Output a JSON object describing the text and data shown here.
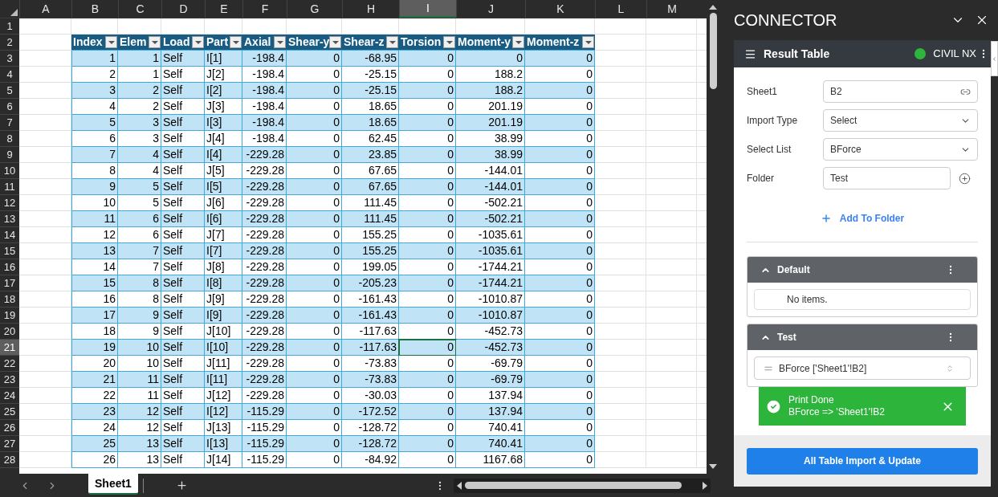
{
  "sheet": {
    "columns": [
      {
        "label": "A",
        "selected": false
      },
      {
        "label": "B",
        "selected": false
      },
      {
        "label": "C",
        "selected": false
      },
      {
        "label": "D",
        "selected": false
      },
      {
        "label": "E",
        "selected": false
      },
      {
        "label": "F",
        "selected": false
      },
      {
        "label": "G",
        "selected": false
      },
      {
        "label": "H",
        "selected": false
      },
      {
        "label": "I",
        "selected": true
      },
      {
        "label": "J",
        "selected": false
      },
      {
        "label": "K",
        "selected": false
      },
      {
        "label": "L",
        "selected": false
      },
      {
        "label": "M",
        "selected": false
      }
    ],
    "rows": [
      {
        "label": "1",
        "selected": false
      },
      {
        "label": "2",
        "selected": false
      },
      {
        "label": "3",
        "selected": false
      },
      {
        "label": "4",
        "selected": false
      },
      {
        "label": "5",
        "selected": false
      },
      {
        "label": "6",
        "selected": false
      },
      {
        "label": "7",
        "selected": false
      },
      {
        "label": "8",
        "selected": false
      },
      {
        "label": "9",
        "selected": false
      },
      {
        "label": "10",
        "selected": false
      },
      {
        "label": "11",
        "selected": false
      },
      {
        "label": "12",
        "selected": false
      },
      {
        "label": "13",
        "selected": false
      },
      {
        "label": "14",
        "selected": false
      },
      {
        "label": "15",
        "selected": false
      },
      {
        "label": "16",
        "selected": false
      },
      {
        "label": "17",
        "selected": false
      },
      {
        "label": "18",
        "selected": false
      },
      {
        "label": "19",
        "selected": false
      },
      {
        "label": "20",
        "selected": false
      },
      {
        "label": "21",
        "selected": true
      },
      {
        "label": "22",
        "selected": false
      },
      {
        "label": "23",
        "selected": false
      },
      {
        "label": "24",
        "selected": false
      },
      {
        "label": "25",
        "selected": false
      },
      {
        "label": "26",
        "selected": false
      },
      {
        "label": "27",
        "selected": false
      },
      {
        "label": "28",
        "selected": false
      }
    ],
    "table": {
      "columns": [
        {
          "label": "Index",
          "kind": "number"
        },
        {
          "label": "Elem",
          "kind": "number"
        },
        {
          "label": "Load",
          "kind": "text"
        },
        {
          "label": "Part",
          "kind": "text"
        },
        {
          "label": "Axial",
          "kind": "number"
        },
        {
          "label": "Shear-y",
          "kind": "number"
        },
        {
          "label": "Shear-z",
          "kind": "number"
        },
        {
          "label": "Torsion",
          "kind": "number"
        },
        {
          "label": "Moment-y",
          "kind": "number"
        },
        {
          "label": "Moment-z",
          "kind": "number"
        }
      ],
      "rows": [
        [
          "1",
          "1",
          "Self",
          "I[1]",
          "-198.4",
          "0",
          "-68.95",
          "0",
          "0",
          "0"
        ],
        [
          "2",
          "1",
          "Self",
          "J[2]",
          "-198.4",
          "0",
          "-25.15",
          "0",
          "188.2",
          "0"
        ],
        [
          "3",
          "2",
          "Self",
          "I[2]",
          "-198.4",
          "0",
          "-25.15",
          "0",
          "188.2",
          "0"
        ],
        [
          "4",
          "2",
          "Self",
          "J[3]",
          "-198.4",
          "0",
          "18.65",
          "0",
          "201.19",
          "0"
        ],
        [
          "5",
          "3",
          "Self",
          "I[3]",
          "-198.4",
          "0",
          "18.65",
          "0",
          "201.19",
          "0"
        ],
        [
          "6",
          "3",
          "Self",
          "J[4]",
          "-198.4",
          "0",
          "62.45",
          "0",
          "38.99",
          "0"
        ],
        [
          "7",
          "4",
          "Self",
          "I[4]",
          "-229.28",
          "0",
          "23.85",
          "0",
          "38.99",
          "0"
        ],
        [
          "8",
          "4",
          "Self",
          "J[5]",
          "-229.28",
          "0",
          "67.65",
          "0",
          "-144.01",
          "0"
        ],
        [
          "9",
          "5",
          "Self",
          "I[5]",
          "-229.28",
          "0",
          "67.65",
          "0",
          "-144.01",
          "0"
        ],
        [
          "10",
          "5",
          "Self",
          "J[6]",
          "-229.28",
          "0",
          "111.45",
          "0",
          "-502.21",
          "0"
        ],
        [
          "11",
          "6",
          "Self",
          "I[6]",
          "-229.28",
          "0",
          "111.45",
          "0",
          "-502.21",
          "0"
        ],
        [
          "12",
          "6",
          "Self",
          "J[7]",
          "-229.28",
          "0",
          "155.25",
          "0",
          "-1035.61",
          "0"
        ],
        [
          "13",
          "7",
          "Self",
          "I[7]",
          "-229.28",
          "0",
          "155.25",
          "0",
          "-1035.61",
          "0"
        ],
        [
          "14",
          "7",
          "Self",
          "J[8]",
          "-229.28",
          "0",
          "199.05",
          "0",
          "-1744.21",
          "0"
        ],
        [
          "15",
          "8",
          "Self",
          "I[8]",
          "-229.28",
          "0",
          "-205.23",
          "0",
          "-1744.21",
          "0"
        ],
        [
          "16",
          "8",
          "Self",
          "J[9]",
          "-229.28",
          "0",
          "-161.43",
          "0",
          "-1010.87",
          "0"
        ],
        [
          "17",
          "9",
          "Self",
          "I[9]",
          "-229.28",
          "0",
          "-161.43",
          "0",
          "-1010.87",
          "0"
        ],
        [
          "18",
          "9",
          "Self",
          "J[10]",
          "-229.28",
          "0",
          "-117.63",
          "0",
          "-452.73",
          "0"
        ],
        [
          "19",
          "10",
          "Self",
          "I[10]",
          "-229.28",
          "0",
          "-117.63",
          "0",
          "-452.73",
          "0"
        ],
        [
          "20",
          "10",
          "Self",
          "J[11]",
          "-229.28",
          "0",
          "-73.83",
          "0",
          "-69.79",
          "0"
        ],
        [
          "21",
          "11",
          "Self",
          "I[11]",
          "-229.28",
          "0",
          "-73.83",
          "0",
          "-69.79",
          "0"
        ],
        [
          "22",
          "11",
          "Self",
          "J[12]",
          "-229.28",
          "0",
          "-30.03",
          "0",
          "137.94",
          "0"
        ],
        [
          "23",
          "12",
          "Self",
          "I[12]",
          "-115.29",
          "0",
          "-172.52",
          "0",
          "137.94",
          "0"
        ],
        [
          "24",
          "12",
          "Self",
          "J[13]",
          "-115.29",
          "0",
          "-128.72",
          "0",
          "740.41",
          "0"
        ],
        [
          "25",
          "13",
          "Self",
          "I[13]",
          "-115.29",
          "0",
          "-128.72",
          "0",
          "740.41",
          "0"
        ],
        [
          "26",
          "13",
          "Self",
          "J[14]",
          "-115.29",
          "0",
          "-84.92",
          "0",
          "1167.68",
          "0"
        ]
      ]
    },
    "tabs": [
      {
        "label": "Sheet1",
        "selected": true
      }
    ]
  },
  "panel": {
    "title": "CONNECTOR",
    "header": {
      "title": "Result Table",
      "status": "CIVIL NX",
      "connected": true
    },
    "fields": [
      {
        "label": "Sheet1",
        "value": "B2",
        "kind": "link"
      },
      {
        "label": "Import Type",
        "value": "Select",
        "kind": "select"
      },
      {
        "label": "Select List",
        "value": "BForce",
        "kind": "select"
      },
      {
        "label": "Folder",
        "value": "Test",
        "kind": "folder"
      }
    ],
    "add_button": "Add To Folder",
    "folders": [
      {
        "name": "Default",
        "expanded": true,
        "empty_text": "No items."
      },
      {
        "name": "Test",
        "expanded": true,
        "items": [
          "BForce ['Sheet1'!B2]"
        ]
      }
    ],
    "toast": {
      "title": "Print Done",
      "message": "BForce => 'Sheet1'!B2"
    },
    "main_button": "All Table Import & Update"
  }
}
